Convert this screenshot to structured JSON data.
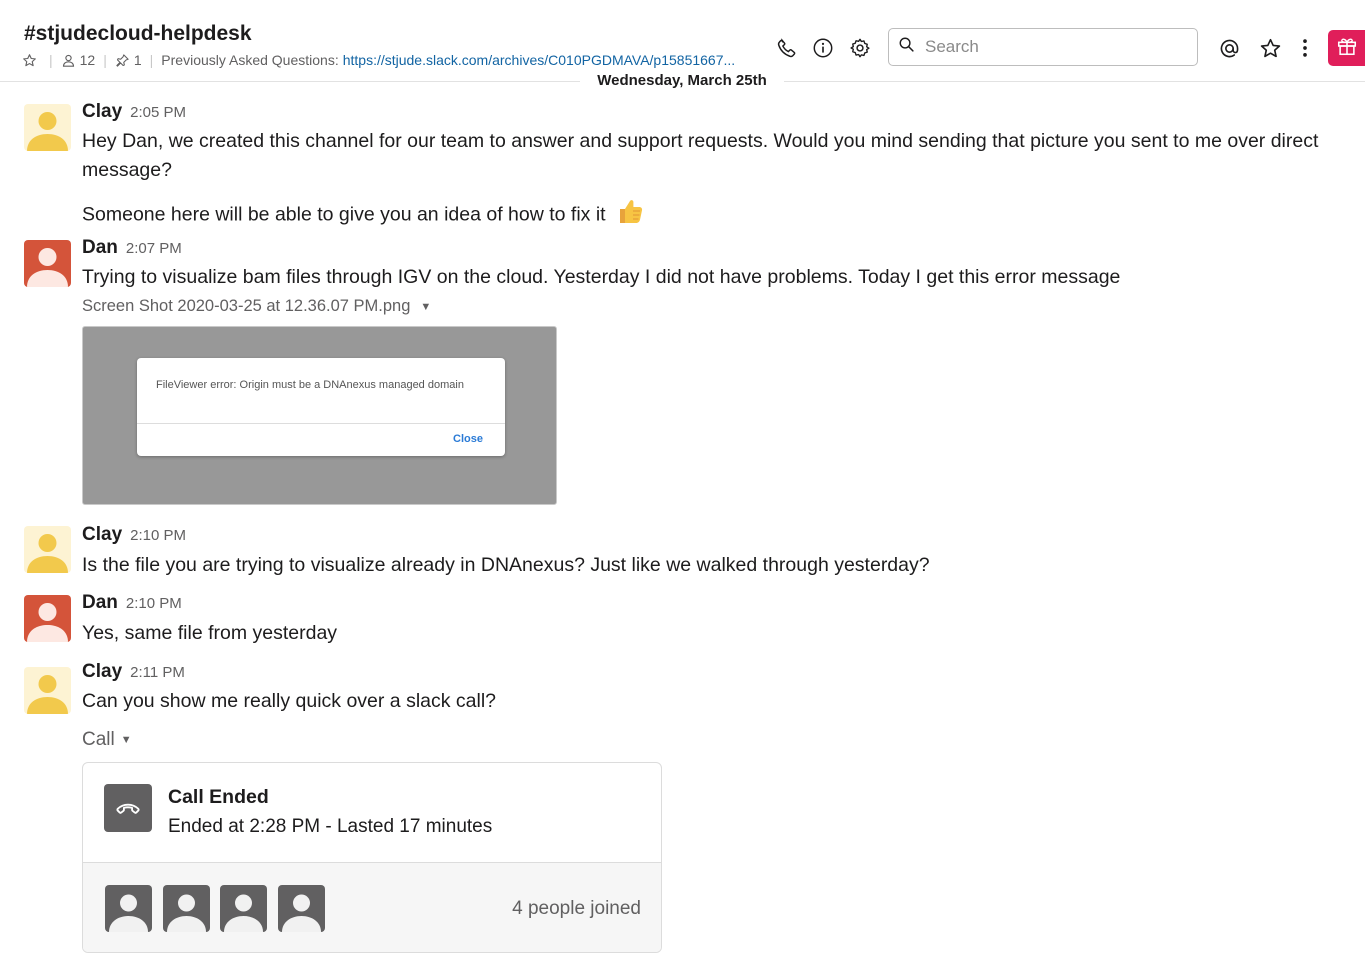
{
  "header": {
    "channel_name": "#stjudecloud-helpdesk",
    "member_count": "12",
    "pinned_count": "1",
    "topic_label": "Previously Asked Questions:",
    "topic_link": "https://stjude.slack.com/archives/C010PGDMAVA/p15851667...",
    "search_placeholder": "Search",
    "icons": [
      "star-outline-icon",
      "person-icon",
      "pin-icon",
      "phone-icon",
      "info-icon",
      "gear-icon",
      "search-icon",
      "mention-icon",
      "star-icon",
      "more-vertical-icon",
      "gift-icon"
    ],
    "gift_color": "#e01e5a"
  },
  "date_divider": "Wednesday, March 25th",
  "messages": [
    {
      "author": "Clay",
      "time": "2:05 PM",
      "avatar_color": "#f2c94c",
      "lines": [
        "Hey Dan, we created this channel for our team to answer and support requests. Would you mind sending that picture you sent to me over direct message?",
        "Someone here will be able to give you an idea of how to fix it"
      ],
      "emoji": "thumbs-up"
    },
    {
      "author": "Dan",
      "time": "2:07 PM",
      "avatar_color": "#d4543a",
      "lines": [
        "Trying to visualize bam files through IGV on the cloud.  Yesterday I did not have problems.  Today I get this error message"
      ],
      "attachment": {
        "file_name": "Screen Shot 2020-03-25 at 12.36.07 PM.png",
        "dialog_text": "FileViewer error: Origin must be a DNAnexus managed domain",
        "dialog_button": "Close"
      }
    },
    {
      "author": "Clay",
      "time": "2:10 PM",
      "avatar_color": "#f2c94c",
      "lines": [
        "Is the file you are trying to visualize already in DNAnexus? Just like we walked through yesterday?"
      ]
    },
    {
      "author": "Dan",
      "time": "2:10 PM",
      "avatar_color": "#d4543a",
      "lines": [
        "Yes, same file from yesterday"
      ]
    },
    {
      "author": "Clay",
      "time": "2:11 PM",
      "avatar_color": "#f2c94c",
      "lines": [
        "Can you show me really quick over a slack call?"
      ]
    }
  ],
  "call": {
    "label": "Call",
    "title": "Call Ended",
    "subtitle": "Ended at 2:28 PM - Lasted 17 minutes",
    "joined": "4 people joined",
    "participant_count": 4
  }
}
